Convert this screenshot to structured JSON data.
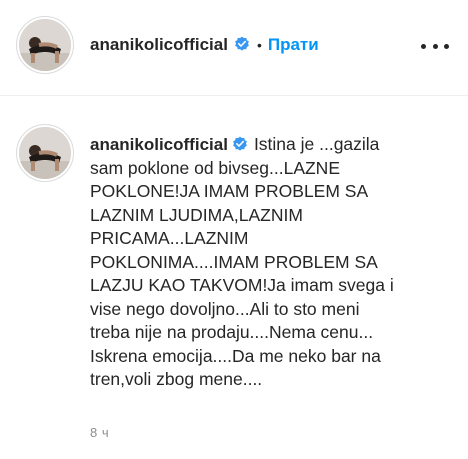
{
  "header": {
    "username": "ananikolicofficial",
    "separator": "•",
    "follow_label": "Прати",
    "avatar_icon": "profile-photo",
    "verified_icon": "verified-badge-icon",
    "more_icon": "more-options-icon"
  },
  "caption": {
    "username": "ananikolicofficial",
    "lines": [
      "Istina je ...gazila",
      "sam poklone od bivseg...LAZNE",
      "POKLONE!JA IMAM PROBLEM SA",
      "LAZNIM LJUDIMA,LAZNIM",
      "PRICAMA...LAZNIM",
      "POKLONIMA....IMAM PROBLEM SA",
      "LAZJU KAO TAKVOM!Ja imam svega i",
      "vise nego dovoljno...Ali to sto meni",
      "treba nije na prodaju....Nema cenu...",
      "Iskrena emocija....Da me neko bar na",
      "tren,voli zbog mene...."
    ],
    "timestamp": "8 ч"
  },
  "colors": {
    "accent": "#0095f6",
    "text": "#262626",
    "muted": "#8e8e8e",
    "divider": "#efefef"
  }
}
